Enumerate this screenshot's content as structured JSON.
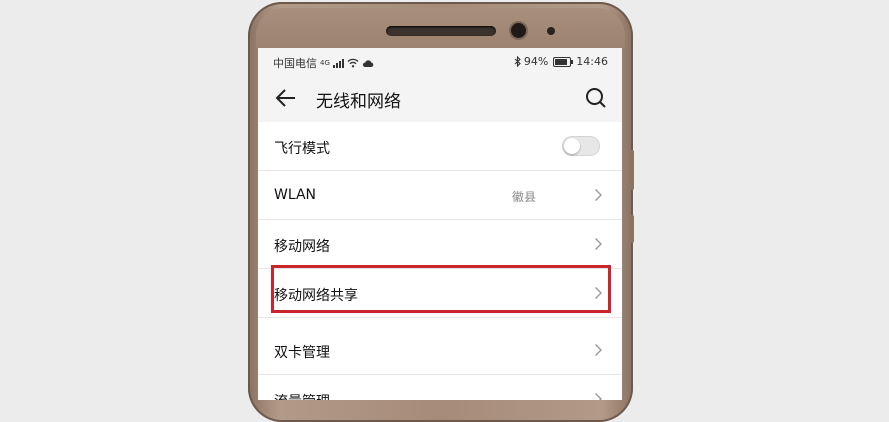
{
  "status_bar": {
    "carrier": "中国电信",
    "network_type": "4G",
    "battery": "94%",
    "time": "14:46",
    "icons": [
      "signal-icon",
      "wifi-icon",
      "cloud-icon",
      "bluetooth-icon",
      "battery-icon"
    ]
  },
  "header": {
    "title": "无线和网络",
    "back_icon": "arrow-left-icon",
    "search_icon": "search-icon"
  },
  "settings": {
    "airplane": {
      "label": "飞行模式",
      "toggle_on": false
    },
    "wlan": {
      "label": "WLAN",
      "value": "徽县"
    },
    "mobile_network": {
      "label": "移动网络"
    },
    "tethering": {
      "label": "移动网络共享",
      "highlighted": true
    },
    "dual_sim": {
      "label": "双卡管理"
    },
    "data_usage": {
      "label": "流量管理"
    }
  },
  "colors": {
    "highlight_border": "#c9252a",
    "phone_frame": "#a58b78",
    "screen_bg": "#ffffff",
    "bar_bg": "#f4f4f4"
  }
}
